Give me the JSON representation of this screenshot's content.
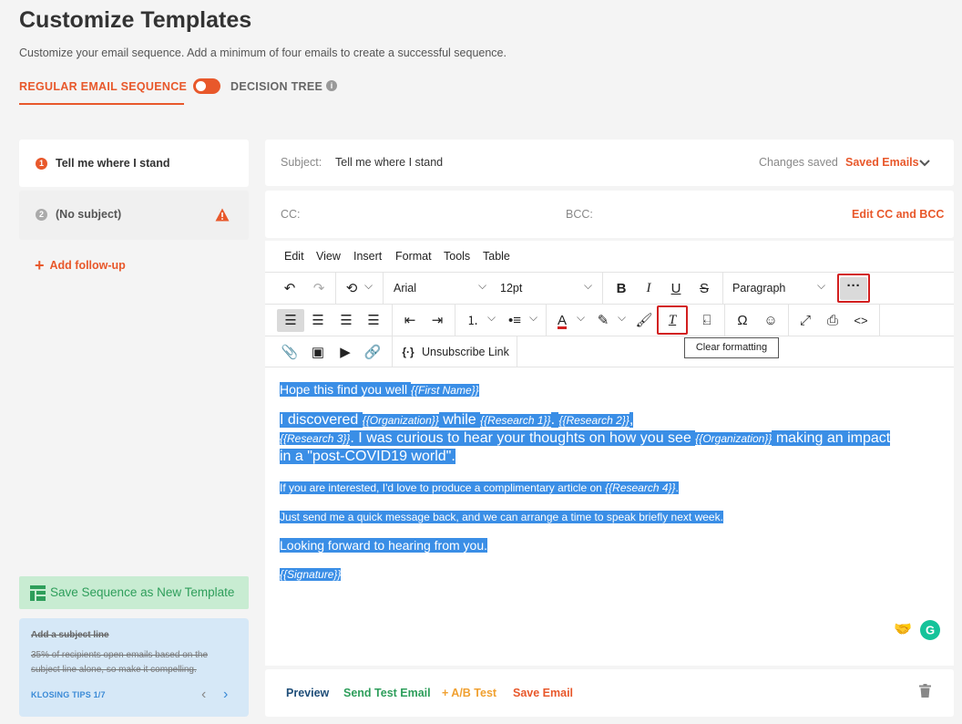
{
  "page": {
    "title": "Customize Templates",
    "subtitle": "Customize your email sequence. Add a minimum of four emails to create a successful sequence."
  },
  "tabs": {
    "regular": "REGULAR EMAIL SEQUENCE",
    "decision": "DECISION TREE",
    "info_icon": "i"
  },
  "sequence": {
    "items": [
      {
        "number": "1",
        "label": "Tell me where I stand"
      },
      {
        "number": "2",
        "label": "(No subject)"
      }
    ],
    "add_followup": "Add follow-up",
    "save_template": "Save Sequence as New Template"
  },
  "tips": {
    "title": "Add a subject line",
    "text": "35% of recipients open emails based on the subject line alone, so make it compelling.",
    "counter": "KLOSING TIPS 1/7"
  },
  "subject": {
    "label": "Subject:",
    "value": "Tell me where I stand",
    "status": "Changes saved",
    "saved_emails": "Saved Emails"
  },
  "cc": {
    "cc_label": "CC:",
    "bcc_label": "BCC:",
    "edit": "Edit CC and BCC"
  },
  "editor": {
    "menu": [
      "Edit",
      "View",
      "Insert",
      "Format",
      "Tools",
      "Table"
    ],
    "font": "Arial",
    "size": "12pt",
    "block": "Paragraph",
    "tooltip": "Clear formatting",
    "unsubscribe": "Unsubscribe Link",
    "body": {
      "l1a": "Hope this find you well ",
      "l1v": "{{First Name}}",
      "l2a": "I discovered ",
      "l2v1": "{{Organization}}",
      "l2b": " while ",
      "l2v2": "{{Research 1}}",
      "l2c": ". ",
      "l2v3": "{{Research 2}}",
      "l2d": ",",
      "l3v": "{{Research 3}}",
      "l3a": ". I was curious to hear your thoughts on how you see ",
      "l3v2": "{{Organization}}",
      "l3b": " making an impact",
      "l4": "in a \"post-COVID19 world\".",
      "l5a": "If you are interested, I'd love to produce a complimentary article on ",
      "l5v": "{{Research 4}}",
      "l5b": ".",
      "l6": "Just send me a quick message back, and we can arrange a time to speak briefly next week.",
      "l7": "Looking forward to hearing from you.",
      "l8": "{{Signature}}"
    }
  },
  "actions": {
    "preview": "Preview",
    "send_test": "Send Test Email",
    "ab_test": "+ A/B Test",
    "save_email": "Save Email"
  },
  "colors": {
    "accent": "#e8582b",
    "green": "#2e9e5b",
    "selection": "#3a8ee6"
  }
}
